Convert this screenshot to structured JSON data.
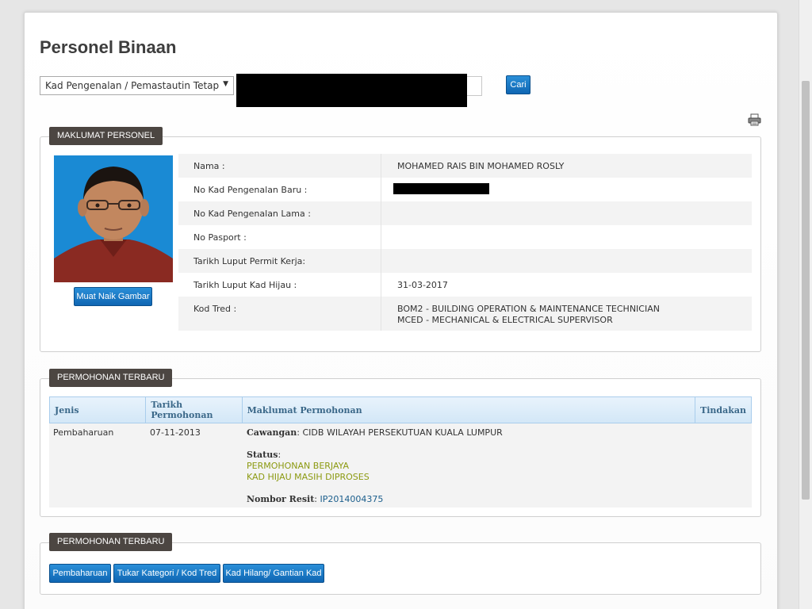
{
  "page": {
    "title": "Personel Binaan"
  },
  "search": {
    "select_value": "Kad Pengenalan / Pemastautin Tetap",
    "button_label": "Cari"
  },
  "personel": {
    "section_label": "MAKLUMAT PERSONEL",
    "upload_label": "Muat Naik Gambar",
    "fields": [
      {
        "label": "Nama :",
        "value": "MOHAMED RAIS BIN MOHAMED ROSLY"
      },
      {
        "label": "No Kad Pengenalan Baru :",
        "value": ""
      },
      {
        "label": "No Kad Pengenalan Lama :",
        "value": ""
      },
      {
        "label": "No Pasport :",
        "value": ""
      },
      {
        "label": "Tarikh Luput Permit Kerja:",
        "value": ""
      },
      {
        "label": "Tarikh Luput Kad Hijau :",
        "value": "31-03-2017"
      },
      {
        "label": "Kod Tred :",
        "value": "BOM2 - BUILDING OPERATION & MAINTENANCE TECHNICIAN",
        "value2": "MCED - MECHANICAL & ELECTRICAL SUPERVISOR"
      }
    ]
  },
  "applications": {
    "section_label": "PERMOHONAN TERBARU",
    "headers": [
      "Jenis",
      "Tarikh Permohonan",
      "Maklumat Permohonan",
      "Tindakan"
    ],
    "row": {
      "jenis": "Pembaharuan",
      "tarikh": "07-11-2013",
      "cawangan_label": "Cawangan",
      "cawangan_value": ": CIDB WILAYAH PERSEKUTUAN KUALA LUMPUR",
      "status_label": "Status",
      "status_colon": ":",
      "status_1": "PERMOHONAN BERJAYA",
      "status_2": "KAD HIJAU MASIH DIPROSES",
      "resit_label": "Nombor Resit",
      "resit_colon": ":",
      "resit_value": "IP2014004375"
    }
  },
  "actions": {
    "section_label": "PERMOHONAN TERBARU",
    "buttons": [
      "Pembaharuan",
      "Tukar Kategori / Kod Tred",
      "Kad Hilang/ Gantian Kad"
    ]
  }
}
